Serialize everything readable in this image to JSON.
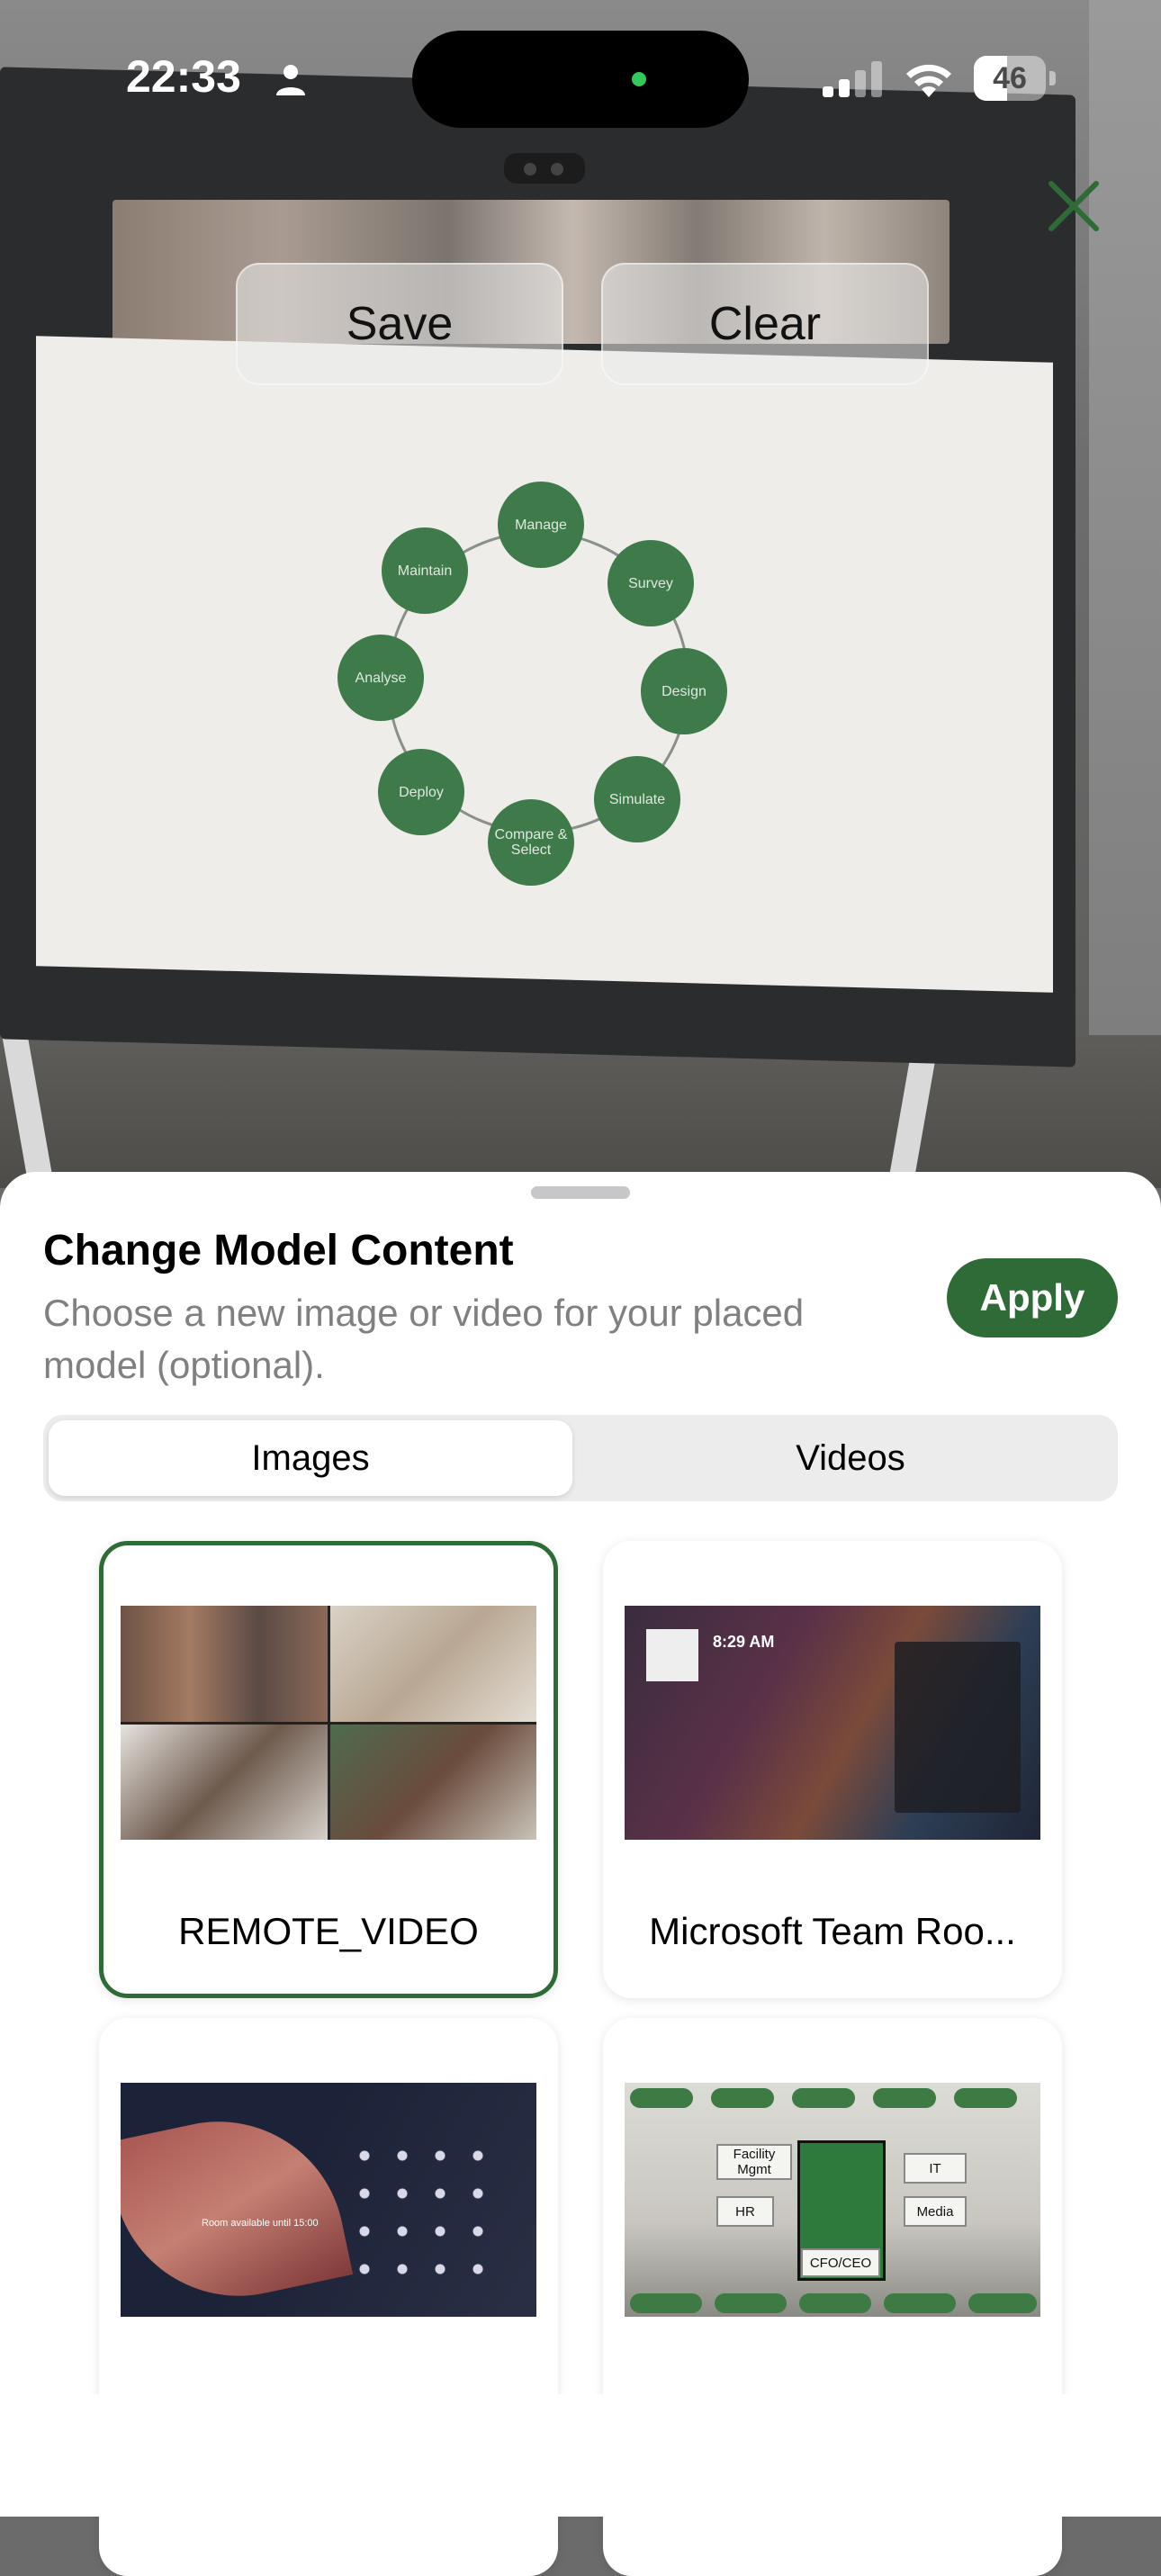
{
  "status_bar": {
    "time": "22:33",
    "battery": "46"
  },
  "ar_view": {
    "save_label": "Save",
    "clear_label": "Clear",
    "close_icon": "close-x-icon",
    "diagram_nodes": [
      "Manage",
      "Survey",
      "Design",
      "Simulate",
      "Compare & Select",
      "Deploy",
      "Analyse",
      "Maintain"
    ]
  },
  "sheet": {
    "title": "Change Model Content",
    "subtitle": "Choose a new image or video for your placed model (optional).",
    "apply_label": "Apply",
    "tabs": [
      {
        "label": "Images",
        "selected": true
      },
      {
        "label": "Videos",
        "selected": false
      }
    ],
    "items": [
      {
        "label": "REMOTE_VIDEO",
        "selected": true
      },
      {
        "label": "Microsoft Team Roo...",
        "selected": false
      },
      {
        "label": "",
        "selected": false
      },
      {
        "label": "",
        "selected": false
      }
    ],
    "thumbnail_text": {
      "teams_time": "8:29 AM",
      "room_status": "Room available until 15:00",
      "plan_boxes": [
        "Facility Mgmt",
        "IT",
        "HR",
        "Media",
        "CFO/CEO"
      ]
    }
  },
  "colors": {
    "accent": "#2e6b37",
    "sheet_bg": "#ffffff",
    "subtitle": "#808080"
  }
}
